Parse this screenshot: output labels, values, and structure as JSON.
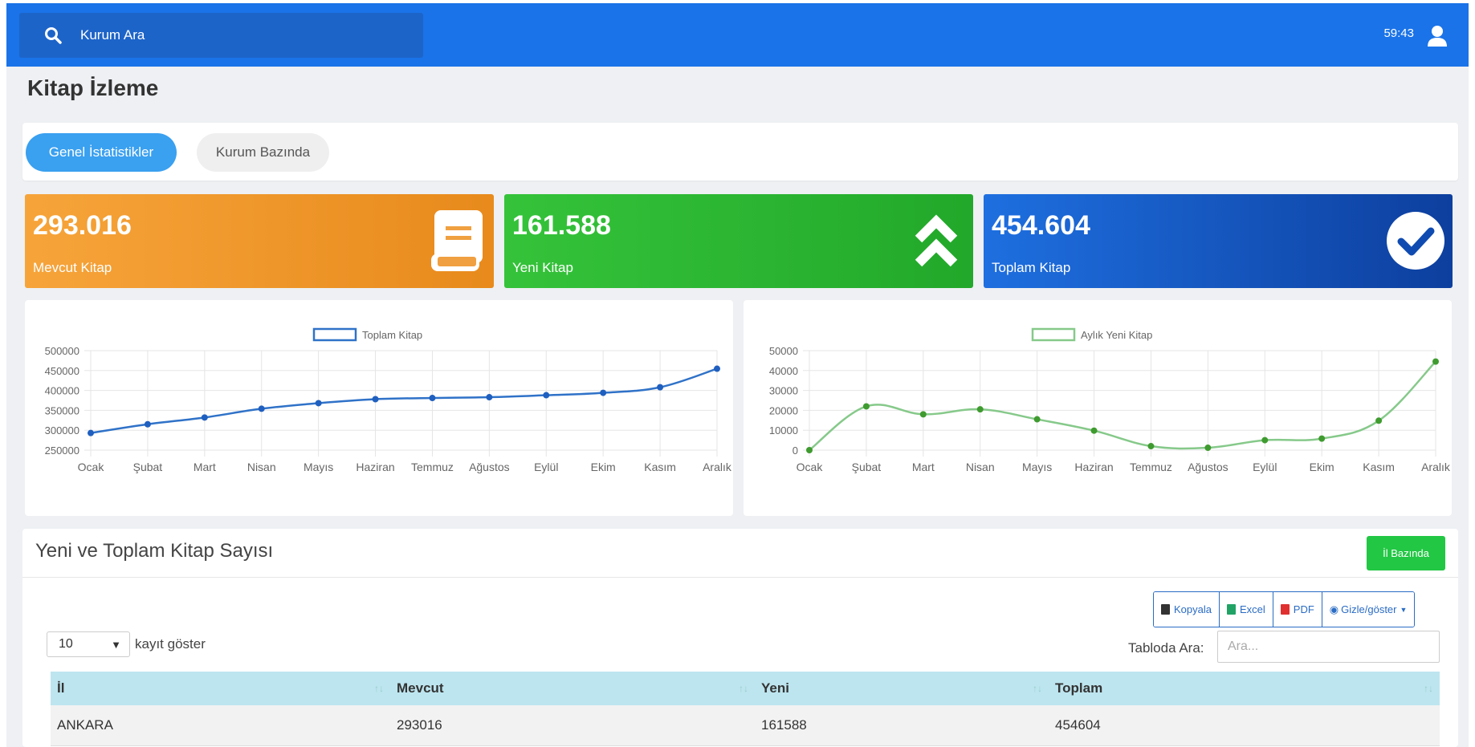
{
  "topbar": {
    "search_label": "Kurum Ara",
    "timer": "59:43"
  },
  "page_title": "Kitap İzleme",
  "tabs": [
    {
      "label": "Genel İstatistikler",
      "active": true
    },
    {
      "label": "Kurum Bazında",
      "active": false
    }
  ],
  "stats": [
    {
      "value": "293.016",
      "label": "Mevcut Kitap",
      "color": "#f39c2d",
      "icon": "book-icon"
    },
    {
      "value": "161.588",
      "label": "Yeni Kitap",
      "color": "#2db834",
      "icon": "double-chevron-up-icon"
    },
    {
      "value": "454.604",
      "label": "Toplam Kitap",
      "color": "#1657c4",
      "icon": "check-circle-icon"
    }
  ],
  "chart_data": [
    {
      "type": "line",
      "x": [
        "Ocak",
        "Şubat",
        "Mart",
        "Nisan",
        "Mayıs",
        "Haziran",
        "Temmuz",
        "Ağustos",
        "Eylül",
        "Ekim",
        "Kasım",
        "Aralık"
      ],
      "series": [
        {
          "name": "Toplam Kitap",
          "values": [
            293016,
            315000,
            332000,
            354000,
            368000,
            378000,
            381000,
            383000,
            388000,
            394000,
            408000,
            454604
          ],
          "color": "#2f72c8"
        }
      ],
      "ylim": [
        250000,
        500000
      ],
      "yticks": [
        "500000",
        "450000",
        "400000",
        "350000",
        "300000",
        "250000"
      ],
      "grid": true,
      "legend": "top-center"
    },
    {
      "type": "line",
      "x": [
        "Ocak",
        "Şubat",
        "Mart",
        "Nisan",
        "Mayıs",
        "Haziran",
        "Temmuz",
        "Ağustos",
        "Eylül",
        "Ekim",
        "Kasım",
        "Aralık"
      ],
      "series": [
        {
          "name": "Aylık Yeni Kitap",
          "values": [
            0,
            22000,
            18000,
            20500,
            15500,
            9800,
            2000,
            1200,
            5000,
            5800,
            14800,
            44500
          ],
          "color": "#86c98a"
        }
      ],
      "ylim": [
        0,
        50000
      ],
      "yticks": [
        "50000",
        "40000",
        "30000",
        "20000",
        "10000",
        "0"
      ],
      "grid": true,
      "legend": "top-center"
    }
  ],
  "table_section": {
    "title": "Yeni ve Toplam Kitap Sayısı",
    "il_button": "İl Bazında",
    "buttons": [
      {
        "label": "Kopyala",
        "icon": "copy-icon",
        "color": "#333333"
      },
      {
        "label": "Excel",
        "icon": "excel-icon",
        "color": "#21a366"
      },
      {
        "label": "PDF",
        "icon": "pdf-icon",
        "color": "#e03030"
      },
      {
        "label": "Gizle/göster",
        "icon": "eye-icon",
        "color": "#2a6cc4"
      }
    ],
    "length_value": "10",
    "length_label": "kayıt göster",
    "search_label": "Tabloda Ara:",
    "search_placeholder": "Ara...",
    "columns": [
      "İl",
      "Mevcut",
      "Yeni",
      "Toplam"
    ],
    "rows": [
      [
        "ANKARA",
        "293016",
        "161588",
        "454604"
      ]
    ]
  }
}
